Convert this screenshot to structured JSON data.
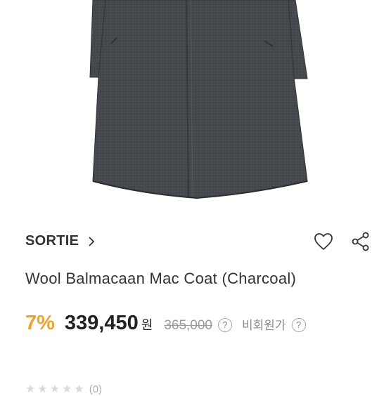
{
  "product": {
    "image_alt": "coat-photo",
    "brand": "SORTIE",
    "title": "Wool Balmacaan Mac Coat (Charcoal)",
    "discount": "7%",
    "price": "339,450",
    "currency": "원",
    "original_price": "365,000",
    "help_symbol": "?",
    "reference_label": "비회원가",
    "rating": 0,
    "review_count": "(0)"
  },
  "icons": {
    "brand_chevron": "chevron-right-icon",
    "wishlist": "heart-icon",
    "share": "share-icon",
    "help": "help-circle-icon"
  },
  "colors": {
    "discount": "#f0a32a",
    "coat": "#45484d"
  }
}
